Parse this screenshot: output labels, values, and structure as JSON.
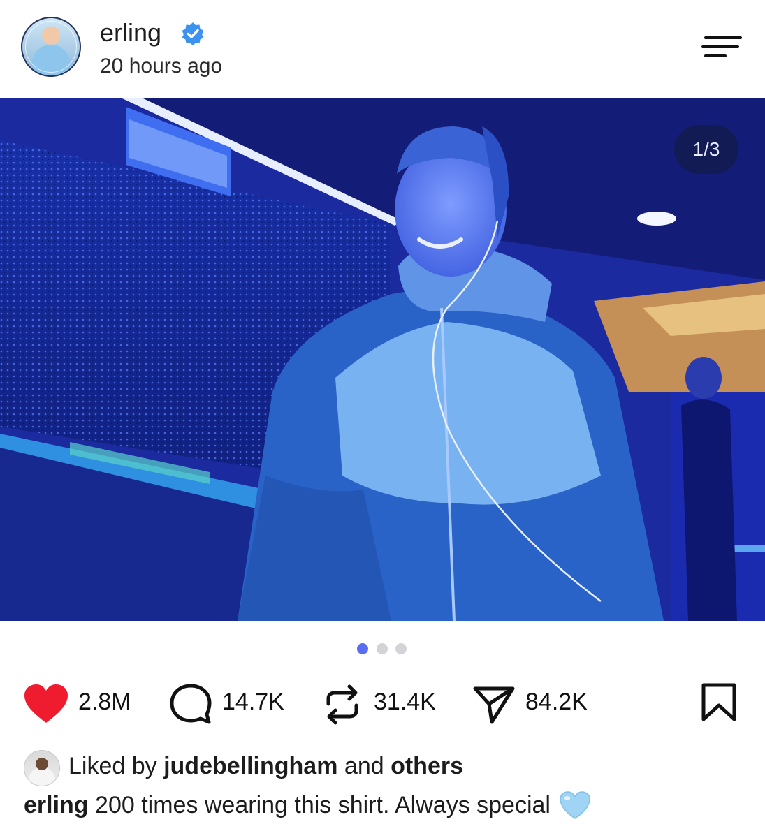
{
  "post": {
    "username": "erling",
    "time_ago": "20 hours ago",
    "verified_icon": "verified-badge-icon",
    "menu_icon": "menu-icon"
  },
  "media": {
    "counter": "1/3",
    "page_dots": [
      true,
      false,
      false
    ]
  },
  "actions": {
    "likes": "2.8M",
    "comments": "14.7K",
    "reposts": "31.4K",
    "shares": "84.2K",
    "icons": [
      "heart-icon",
      "comment-icon",
      "repost-icon",
      "share-icon",
      "bookmark-icon"
    ]
  },
  "likes_line": {
    "prefix": "Liked by",
    "liker": "judebellingham",
    "conjunction": "and",
    "others": "others"
  },
  "caption": {
    "username": "erling",
    "text": "200 times wearing this shirt. Always special",
    "emoji": "light-blue-heart"
  },
  "colors": {
    "heart": "#ee1c2e",
    "verified": "#3b92ef",
    "active_dot": "#5b6cf2",
    "inactive_dot": "#d4d4d8",
    "emoji_heart": "#9fd4f5"
  }
}
